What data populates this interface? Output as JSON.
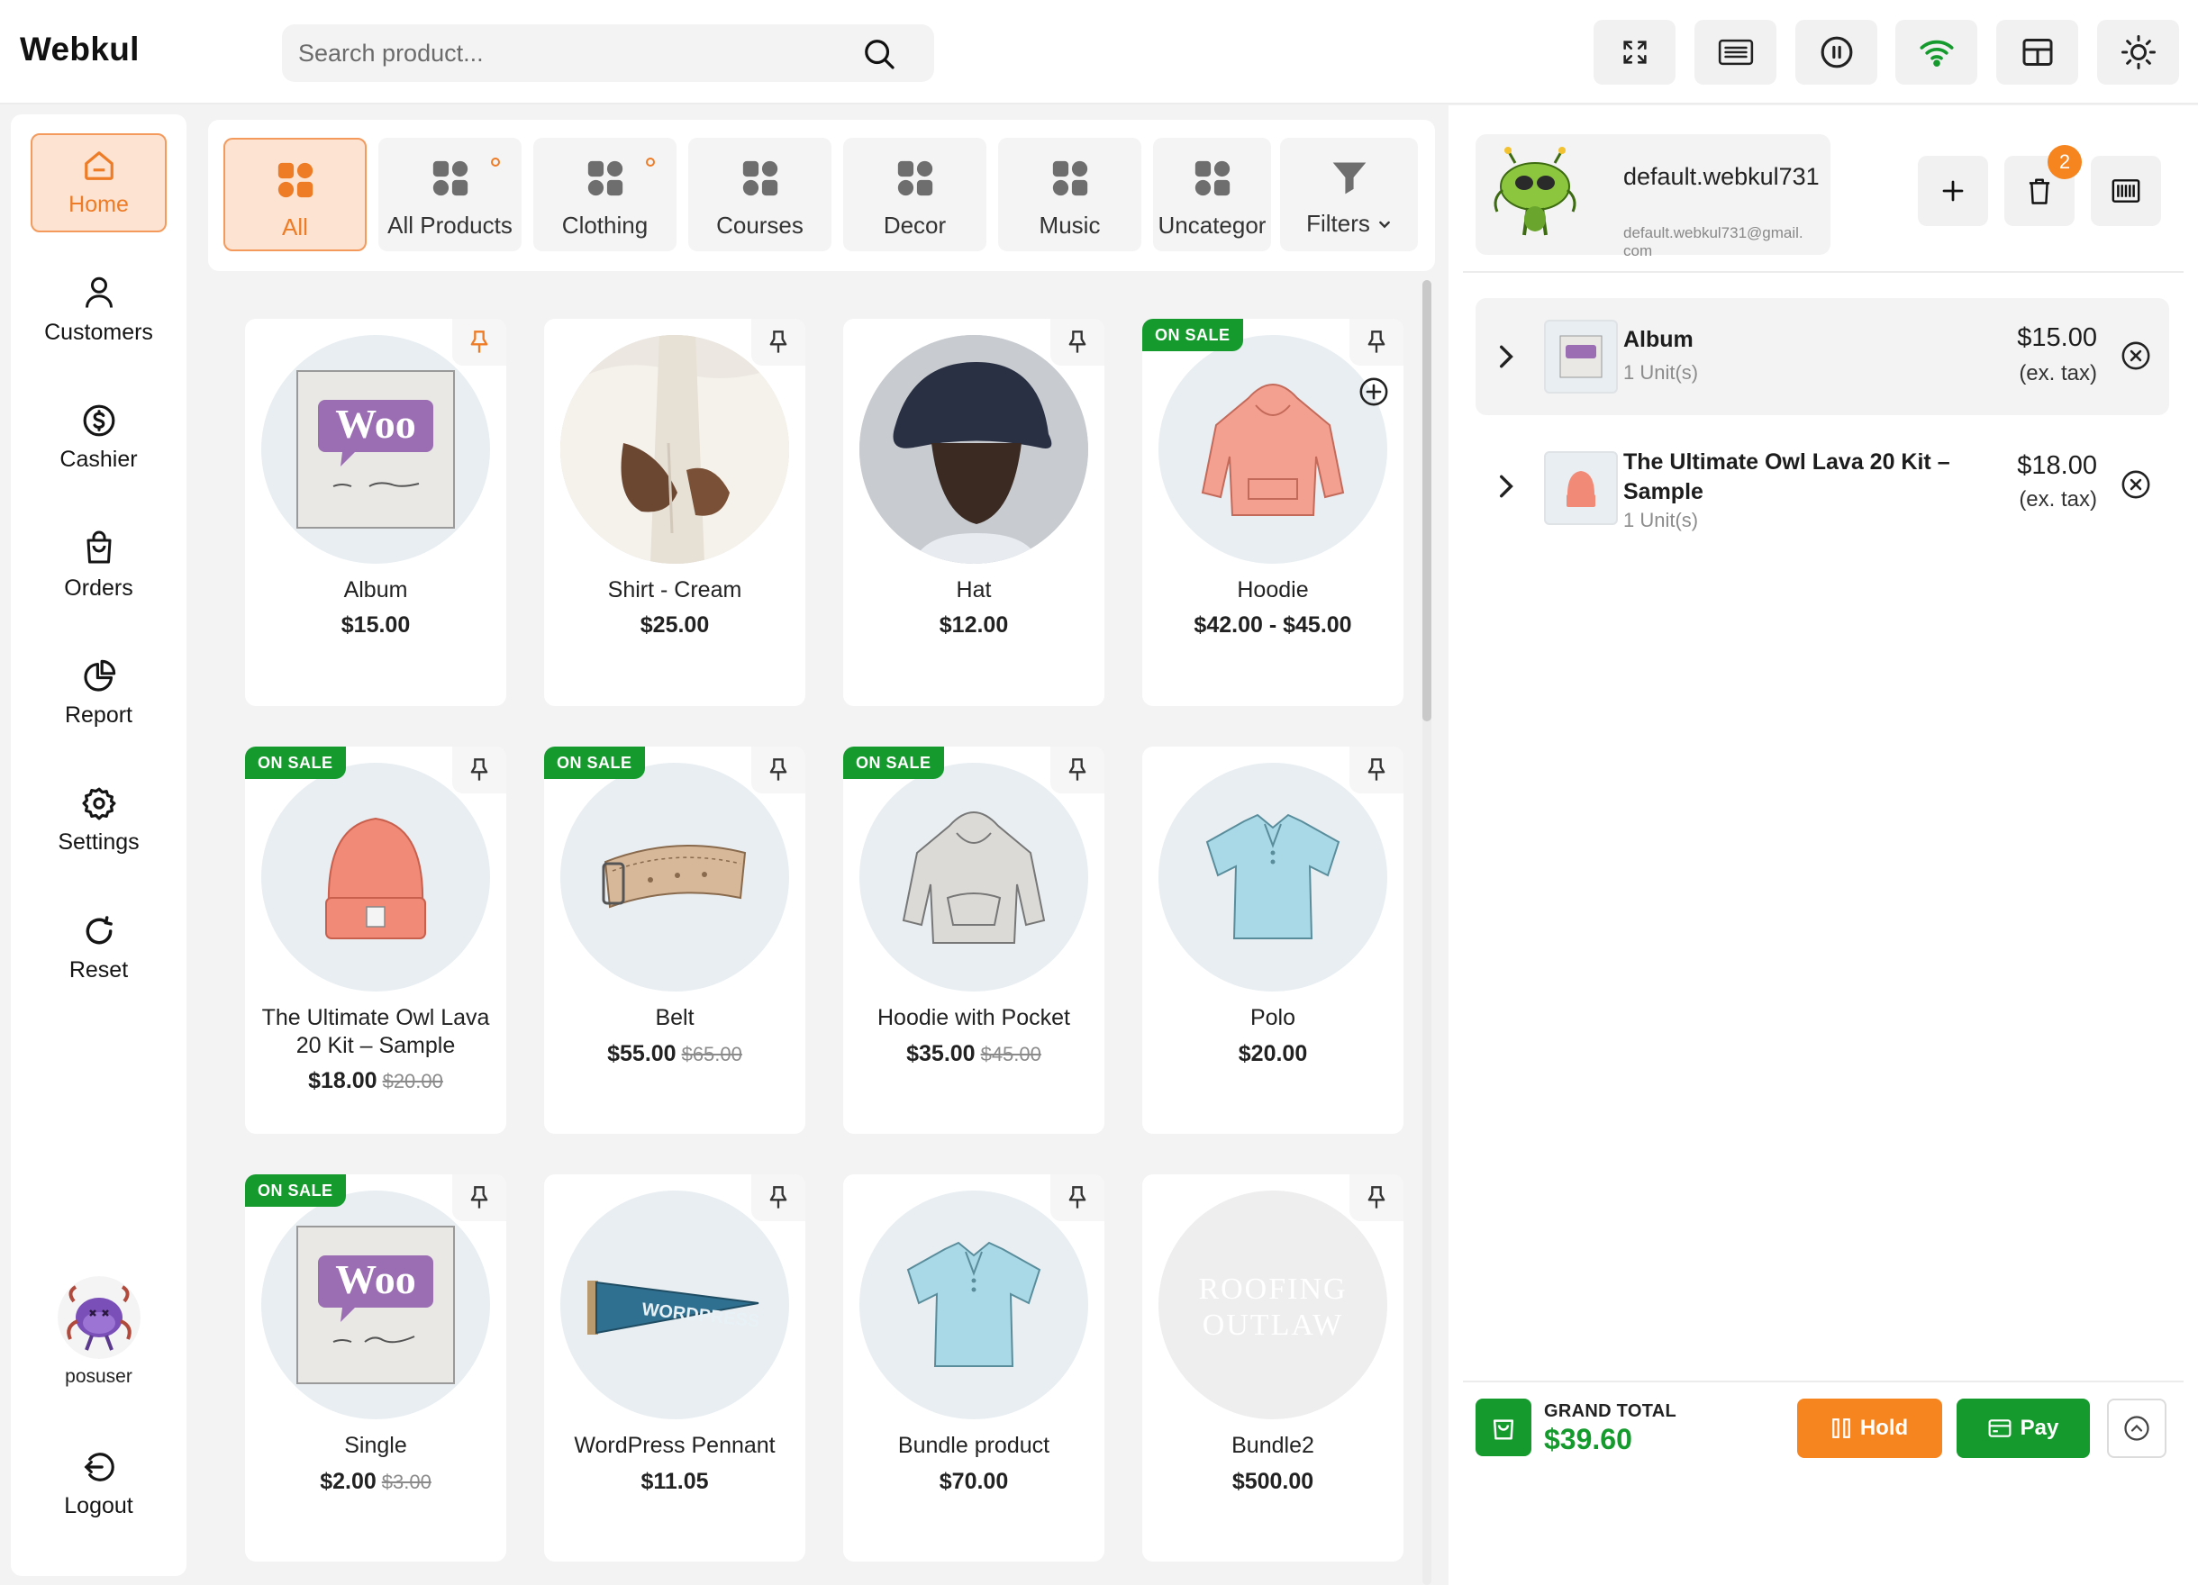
{
  "app": {
    "brand": "Webkul"
  },
  "search": {
    "placeholder": "Search product..."
  },
  "header_buttons": [
    {
      "icon": "fullscreen-icon"
    },
    {
      "icon": "keyboard-icon"
    },
    {
      "icon": "pause-icon"
    },
    {
      "icon": "wifi-icon"
    },
    {
      "icon": "layout-icon"
    },
    {
      "icon": "sun-icon"
    }
  ],
  "sidebar": {
    "items": [
      {
        "label": "Home",
        "icon": "home-icon",
        "active": true
      },
      {
        "label": "Customers",
        "icon": "user-icon"
      },
      {
        "label": "Cashier",
        "icon": "dollar-icon"
      },
      {
        "label": "Orders",
        "icon": "bag-icon"
      },
      {
        "label": "Report",
        "icon": "pie-chart-icon"
      },
      {
        "label": "Settings",
        "icon": "gear-icon"
      },
      {
        "label": "Reset",
        "icon": "refresh-icon"
      }
    ],
    "user": {
      "name": "posuser"
    },
    "logout": {
      "label": "Logout",
      "icon": "logout-icon"
    }
  },
  "categories": [
    {
      "label": "All",
      "active": true
    },
    {
      "label": "All Products",
      "has_children": true
    },
    {
      "label": "Clothing",
      "has_children": true
    },
    {
      "label": "Courses"
    },
    {
      "label": "Decor"
    },
    {
      "label": "Music"
    },
    {
      "label": "Uncategorized"
    },
    {
      "label": "Filters",
      "icon": "filter-icon"
    }
  ],
  "products": [
    {
      "name": "Album",
      "price": "$15.00",
      "old_price": "",
      "sale": "",
      "pinned": true,
      "image": "woo-album"
    },
    {
      "name": "Shirt - Cream",
      "price": "$25.00",
      "old_price": "",
      "sale": "",
      "image": "shirt-cream"
    },
    {
      "name": "Hat",
      "price": "$12.00",
      "old_price": "",
      "sale": "",
      "image": "hat"
    },
    {
      "name": "Hoodie",
      "price": "$42.00 - $45.00",
      "old_price": "",
      "sale": "ON SALE",
      "variable": true,
      "image": "hoodie-pink"
    },
    {
      "name": "The Ultimate Owl Lava 20 Kit – Sample",
      "price": "$18.00",
      "old_price": "$20.00",
      "sale": "ON SALE",
      "image": "beanie"
    },
    {
      "name": "Belt",
      "price": "$55.00",
      "old_price": "$65.00",
      "sale": "ON SALE",
      "image": "belt"
    },
    {
      "name": "Hoodie with Pocket",
      "price": "$35.00",
      "old_price": "$45.00",
      "sale": "ON SALE",
      "image": "hoodie-grey"
    },
    {
      "name": "Polo",
      "price": "$20.00",
      "old_price": "",
      "sale": "",
      "image": "polo"
    },
    {
      "name": "Single",
      "price": "$2.00",
      "old_price": "$3.00",
      "sale": "ON SALE",
      "image": "woo-single"
    },
    {
      "name": "WordPress Pennant",
      "price": "$11.05",
      "old_price": "",
      "sale": "",
      "image": "pennant"
    },
    {
      "name": "Bundle product",
      "price": "$70.00",
      "old_price": "",
      "sale": "",
      "image": "polo"
    },
    {
      "name": "Bundle2",
      "price": "$500.00",
      "old_price": "",
      "sale": "",
      "image": "roofing",
      "image_text": [
        "ROOFING",
        "OUTLAW"
      ]
    }
  ],
  "customer": {
    "name": "default.webkul731",
    "email_line1": "default.webkul731@gmail.",
    "email_line2": "com"
  },
  "cart_actions": {
    "count": "2"
  },
  "cart": {
    "items": [
      {
        "name": "Album",
        "units": "1 Unit(s)",
        "price": "$15.00",
        "tax": "(ex. tax)"
      },
      {
        "name": "The Ultimate Owl Lava 20 Kit – Sample",
        "units": "1 Unit(s)",
        "price": "$18.00",
        "tax": "(ex. tax)"
      }
    ],
    "grand_total_label": "GRAND TOTAL",
    "grand_total": "$39.60",
    "hold_label": "Hold",
    "pay_label": "Pay"
  },
  "colors": {
    "accent": "#ee7c27",
    "sale": "#159a2d",
    "hold": "#f6841f"
  }
}
